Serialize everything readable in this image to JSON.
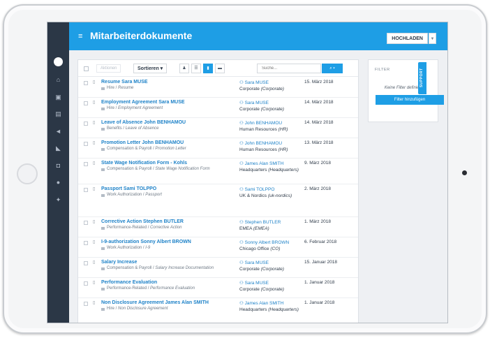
{
  "header": {
    "title": "Mitarbeiterdokumente",
    "upload_label": "HOCHLADEN"
  },
  "toolbar": {
    "action_label": "Aktionen",
    "sort_label": "Sortieren",
    "search_placeholder": "Suche...",
    "view_buttons": [
      "person-icon",
      "list-icon",
      "document-icon",
      "folder-icon"
    ]
  },
  "documents": [
    {
      "name": "Resume Sara MUSE",
      "category": "Hire",
      "subcategory": "Resume",
      "owner": "Sara MUSE",
      "dept": "Corporate",
      "dept_code": "Corporate",
      "date": "15. März 2018"
    },
    {
      "name": "Employment Agreement Sara MUSE",
      "category": "Hire",
      "subcategory": "Employment Agreement",
      "owner": "Sara MUSE",
      "dept": "Corporate",
      "dept_code": "Corporate",
      "date": "14. März 2018"
    },
    {
      "name": "Leave of Absence John BENHAMOU",
      "category": "Benefits",
      "subcategory": "Leave of Absence",
      "owner": "John BENHAMOU",
      "dept": "Human Resources",
      "dept_code": "HR",
      "date": "14. März 2018"
    },
    {
      "name": "Promotion Letter John BENHAMOU",
      "category": "Compensation & Payroll",
      "subcategory": "Promotion Letter",
      "owner": "John BENHAMOU",
      "dept": "Human Resources",
      "dept_code": "HR",
      "date": "13. März 2018"
    },
    {
      "name": "State Wage Notification Form - Kohls",
      "category": "Compensation & Payroll",
      "subcategory": "State Wage Notification Form",
      "owner": "James Alan SMITH",
      "dept": "Headquarters",
      "dept_code": "Headquarters",
      "date": "9. März 2018"
    },
    {
      "name": "Passport Sami TOLPPO",
      "category": "Work Authorization",
      "subcategory": "Passport",
      "owner": "Sami TOLPPO",
      "dept": "UK & Nordics",
      "dept_code": "uk-nordics",
      "date": "2. März 2018"
    },
    {
      "name": "Corrective Action Stephen BUTLER",
      "category": "Performance-Related",
      "subcategory": "Corrective Action",
      "owner": "Stephen BUTLER",
      "dept": "EMEA",
      "dept_code": "EMEA",
      "date": "1. März 2018"
    },
    {
      "name": "I-9-authorization Sonny Albert BROWN",
      "category": "Work Authorization",
      "subcategory": "I-9",
      "owner": "Sonny Albert BROWN",
      "dept": "Chicago Office",
      "dept_code": "CO",
      "date": "6. Februar 2018"
    },
    {
      "name": "Salary Increase",
      "category": "Compensation & Payroll",
      "subcategory": "Salary Increase Documentation",
      "owner": "Sara MUSE",
      "dept": "Corporate",
      "dept_code": "Corporate",
      "date": "15. Januar 2018"
    },
    {
      "name": "Performance Evaluation",
      "category": "Performance-Related",
      "subcategory": "Performance Evaluation",
      "owner": "Sara MUSE",
      "dept": "Corporate",
      "dept_code": "Corporate",
      "date": "1. Januar 2018"
    },
    {
      "name": "Non Disclosure Agreement James Alan SMITH",
      "category": "Hire",
      "subcategory": "Non Disclosure Agreement",
      "owner": "James Alan SMITH",
      "dept": "Headquarters",
      "dept_code": "Headquarters",
      "date": "1. Januar 2018"
    }
  ],
  "filter": {
    "title": "FILTER",
    "none_text": "Keine Filter definiert",
    "add_label": "Filter hinzufügen"
  },
  "support_label": "SUPPORT",
  "colors": {
    "accent": "#1e9ee5",
    "rail": "#2b3746",
    "link": "#1e82c8"
  }
}
